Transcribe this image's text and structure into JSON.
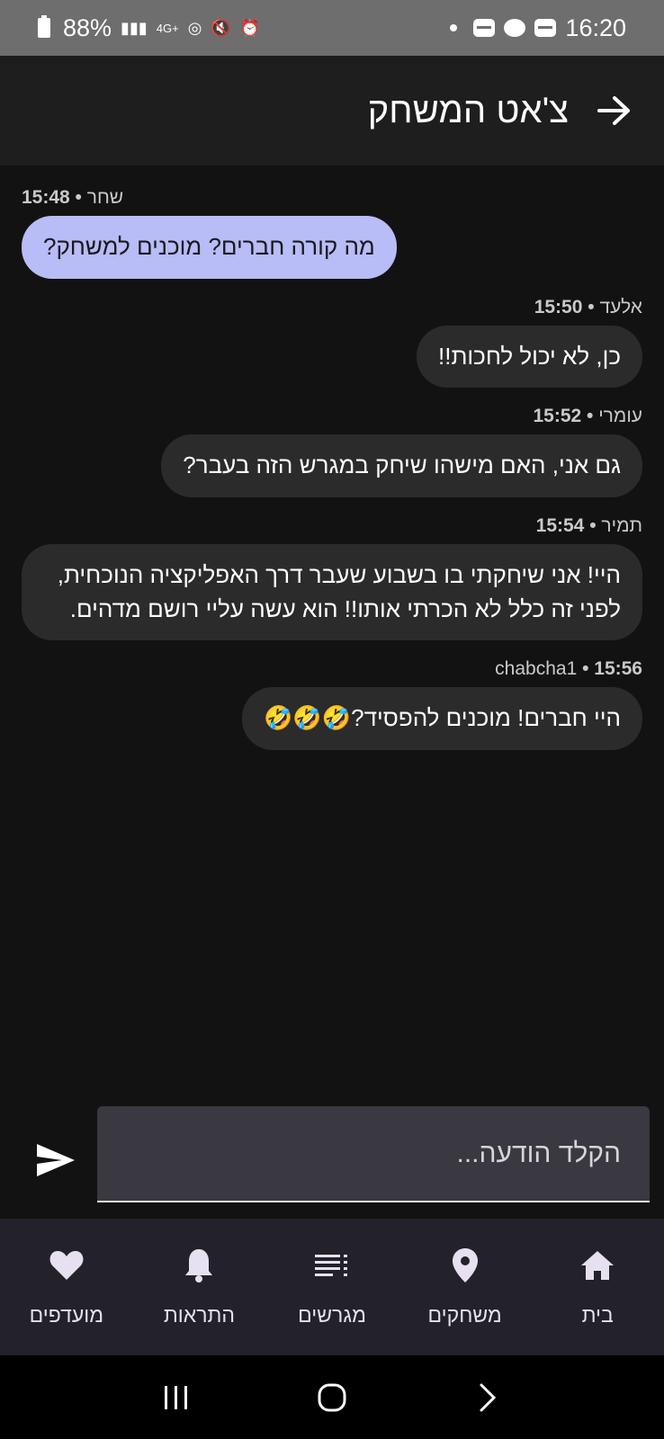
{
  "status_bar": {
    "battery": "88%",
    "network": "4G+",
    "time": "16:20"
  },
  "app_bar": {
    "title": "צ'אט המשחק"
  },
  "messages": [
    {
      "sender": "שחר",
      "time": "15:48",
      "text": "מה קורה חברים? מוכנים למשחק?",
      "side": "left",
      "mine": true
    },
    {
      "sender": "אלעד",
      "time": "15:50",
      "text": "כן, לא יכול לחכות!!",
      "side": "right",
      "mine": false
    },
    {
      "sender": "עומרי",
      "time": "15:52",
      "text": "גם אני, האם מישהו שיחק במגרש הזה בעבר?",
      "side": "right",
      "mine": false
    },
    {
      "sender": "תמיר",
      "time": "15:54",
      "text": "היי! אני שיחקתי בו בשבוע שעבר דרך האפליקציה הנוכחית, לפני זה כלל לא הכרתי אותו!! הוא עשה עליי רושם מדהים.",
      "side": "right",
      "mine": false
    },
    {
      "sender": "chabcha1",
      "time": "15:56",
      "text": "היי חברים! מוכנים להפסיד?🤣🤣🤣",
      "side": "right",
      "mine": false
    }
  ],
  "input": {
    "placeholder": "הקלד הודעה..."
  },
  "bottom_nav": {
    "items": [
      {
        "label": "בית",
        "icon": "home-icon"
      },
      {
        "label": "משחקים",
        "icon": "location-pin-icon"
      },
      {
        "label": "מגרשים",
        "icon": "list-icon"
      },
      {
        "label": "התראות",
        "icon": "bell-icon"
      },
      {
        "label": "מועדפים",
        "icon": "heart-icon"
      }
    ]
  },
  "colors": {
    "my_bubble": "#b8bcf7",
    "other_bubble": "#2b2b2b",
    "background": "#121212"
  }
}
